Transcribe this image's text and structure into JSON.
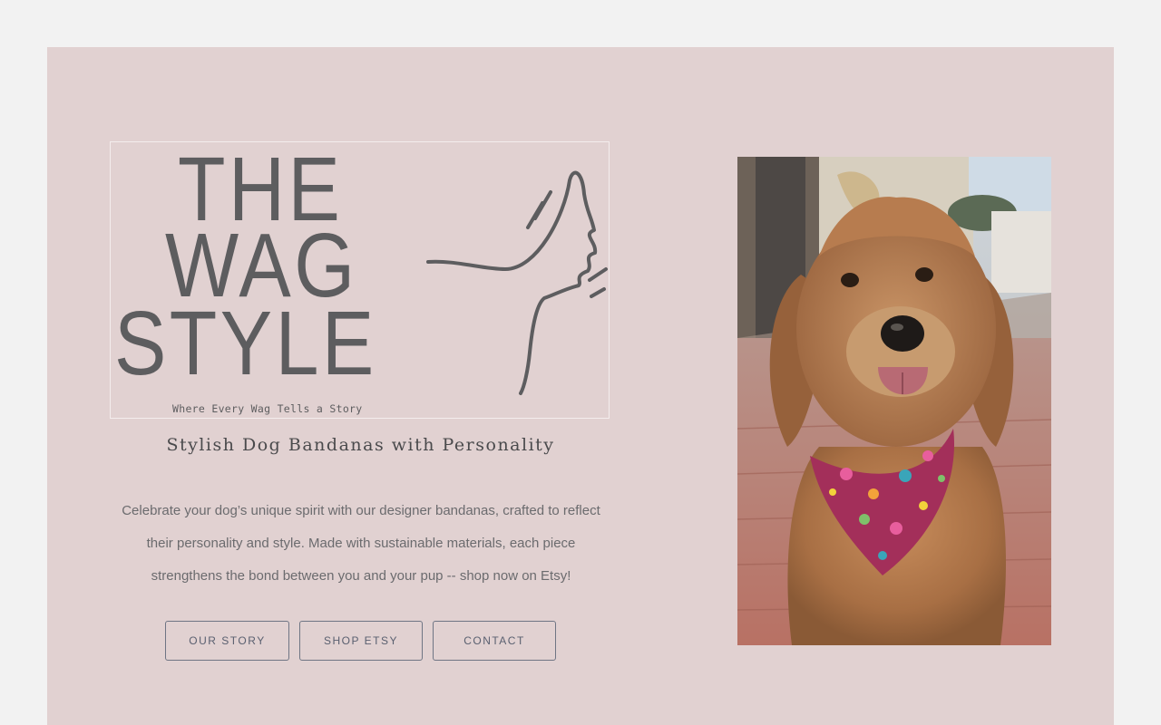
{
  "logo": {
    "line1": "THE",
    "line2": "WAG",
    "line3": "STYLE",
    "tagline": "Where Every Wag Tells a Story"
  },
  "hero": {
    "subtitle": "Stylish Dog Bandanas with Personality",
    "description_lines": [
      "Celebrate your dog’s unique spirit with our designer bandanas, crafted to reflect",
      "their personality and style. Made with sustainable materials, each piece",
      "strengthens the bond between you and your pup -- shop now on Etsy!"
    ]
  },
  "buttons": {
    "our_story": "OUR STORY",
    "shop_etsy": "SHOP ETSY",
    "contact": "CONTACT"
  },
  "colors": {
    "page_bg": "#f2f2f2",
    "hero_bg": "#e1d1d1",
    "logo_ink": "#5d5d5f",
    "button_border": "#6f7584"
  }
}
